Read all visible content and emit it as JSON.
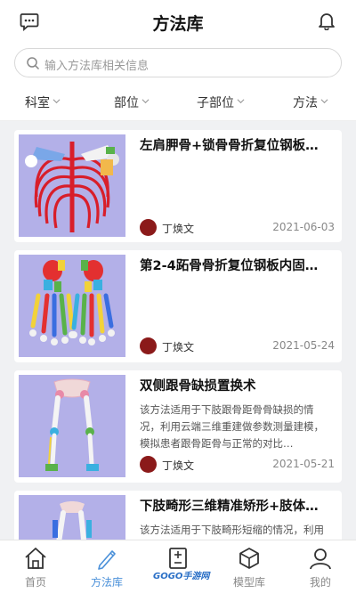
{
  "header": {
    "title": "方法库",
    "left_icon": "message-icon",
    "right_icon": "bell-icon"
  },
  "search": {
    "placeholder": "输入方法库相关信息"
  },
  "filters": [
    {
      "label": "科室"
    },
    {
      "label": "部位"
    },
    {
      "label": "子部位"
    },
    {
      "label": "方法"
    }
  ],
  "cards": [
    {
      "title": "左肩胛骨+锁骨骨折复位钢板…",
      "description": "",
      "author": "丁焕文",
      "date": "2021-06-03"
    },
    {
      "title": "第2-4跖骨骨折复位钢板内固…",
      "description": "",
      "author": "丁焕文",
      "date": "2021-05-24"
    },
    {
      "title": "双侧跟骨缺损置换术",
      "description": "该方法适用于下肢跟骨距骨骨缺损的情况，利用云端三维重建做参数测量建模，模拟患者跟骨距骨与正常的对比…",
      "author": "丁焕文",
      "date": "2021-05-21"
    },
    {
      "title": "下肢畸形三维精准矫形+肢体…",
      "description": "该方法适用于下肢畸形短缩的情况，利用云端三维重建做参数测量建模",
      "author": "",
      "date": ""
    }
  ],
  "tabbar": [
    {
      "label": "首页",
      "icon": "home-icon"
    },
    {
      "label": "方法库",
      "icon": "pen-icon",
      "active": true
    },
    {
      "label": "",
      "icon": "calculator-icon"
    },
    {
      "label": "模型库",
      "icon": "cube-icon"
    },
    {
      "label": "我的",
      "icon": "user-icon"
    }
  ],
  "watermark": "GOGO手游网",
  "colors": {
    "accent": "#4a90d9",
    "thumb_bg": "#b3b0e8",
    "bone_red": "#d81e2a"
  }
}
